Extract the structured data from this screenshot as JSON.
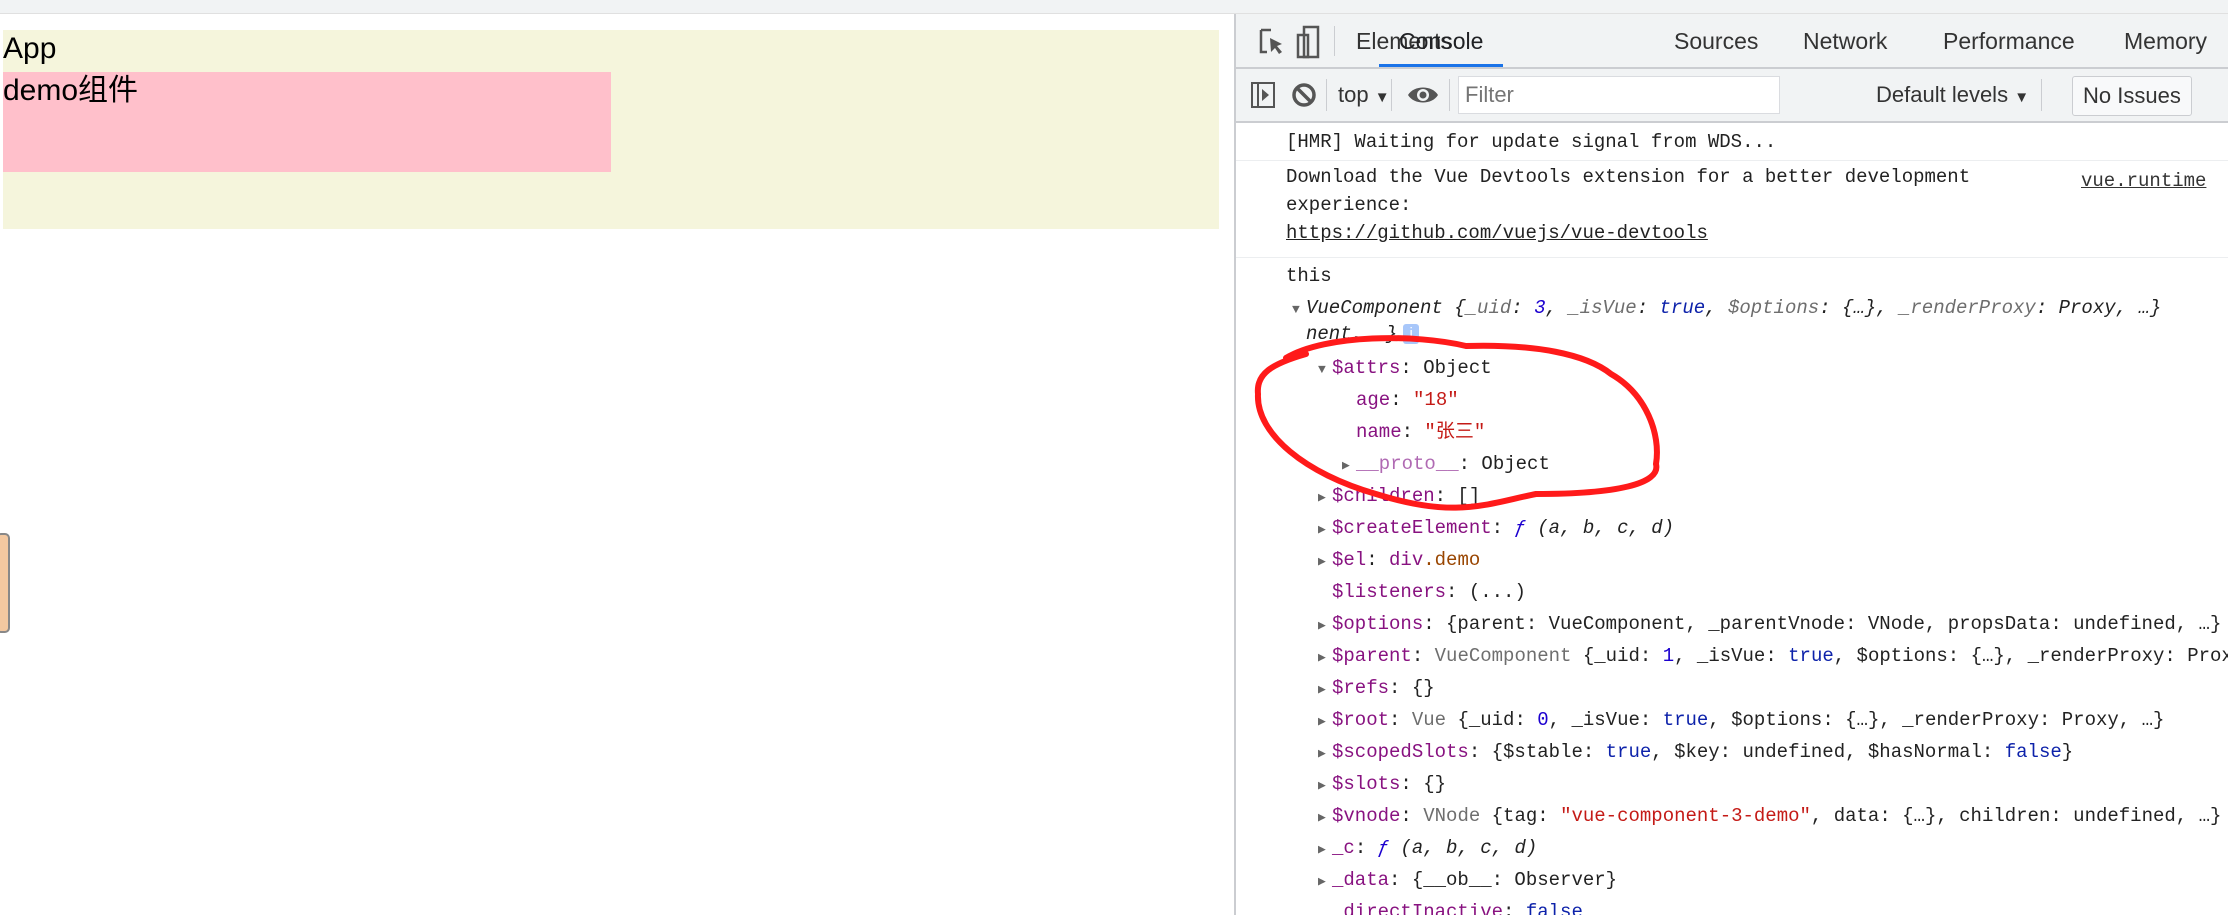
{
  "page": {
    "app_label": "App",
    "demo_label": "demo组件"
  },
  "devtools": {
    "tabs": [
      {
        "label": "Elements",
        "active": false
      },
      {
        "label": "Console",
        "active": true
      },
      {
        "label": "Sources",
        "active": false
      },
      {
        "label": "Network",
        "active": false
      },
      {
        "label": "Performance",
        "active": false
      },
      {
        "label": "Memory",
        "active": false
      }
    ],
    "toolbar": {
      "context": "top",
      "filter_placeholder": "Filter",
      "levels": "Default levels",
      "issues": "No Issues"
    },
    "messages": {
      "hmr": "[HMR] Waiting for update signal from WDS...",
      "vue_devtools_line1": "Download the Vue Devtools extension for a better development",
      "vue_devtools_line2": "experience:",
      "vue_devtools_link": "https://github.com/vuejs/vue-devtools",
      "source_link": "vue.runtime",
      "log_label": "this"
    },
    "colors": {
      "accent": "#1a73e8",
      "annotation": "#ff1a1a"
    },
    "tree": [
      {
        "indent": 0,
        "arrow": "down",
        "segs": [
          [
            "VueComponent {",
            "t i"
          ],
          [
            "_uid",
            "g i"
          ],
          [
            ": ",
            "t i"
          ],
          [
            "3",
            "n i"
          ],
          [
            ", ",
            "t i"
          ],
          [
            "_isVue",
            "g i"
          ],
          [
            ": ",
            "t i"
          ],
          [
            "true",
            "b i"
          ],
          [
            ", ",
            "t i"
          ],
          [
            "$options",
            "g i"
          ],
          [
            ": {…}, ",
            "t i"
          ],
          [
            "_renderProxy",
            "g i"
          ],
          [
            ": Proxy, …}",
            "t i"
          ]
        ]
      },
      {
        "indent": 0,
        "arrow": "",
        "segs": [
          [
            "nent, …}",
            "t i"
          ]
        ],
        "badge": "i"
      },
      {
        "indent": 1,
        "arrow": "down",
        "segs": [
          [
            "$attrs",
            "k"
          ],
          [
            ": Object",
            "t"
          ]
        ]
      },
      {
        "indent": 2,
        "arrow": "",
        "segs": [
          [
            "age",
            "k"
          ],
          [
            ": ",
            "t"
          ],
          [
            "\"18\"",
            "s"
          ]
        ]
      },
      {
        "indent": 2,
        "arrow": "",
        "segs": [
          [
            "name",
            "k"
          ],
          [
            ": ",
            "t"
          ],
          [
            "\"张三\"",
            "s"
          ]
        ]
      },
      {
        "indent": 2,
        "arrow": "right",
        "segs": [
          [
            "__proto__",
            "kd"
          ],
          [
            ": Object",
            "t"
          ]
        ]
      },
      {
        "indent": 1,
        "arrow": "right",
        "segs": [
          [
            "$children",
            "k"
          ],
          [
            ": []",
            "t"
          ]
        ]
      },
      {
        "indent": 1,
        "arrow": "right",
        "segs": [
          [
            "$createElement",
            "k"
          ],
          [
            ": ",
            "t"
          ],
          [
            "ƒ",
            "n i"
          ],
          [
            " (a, b, c, d)",
            "t i"
          ]
        ]
      },
      {
        "indent": 1,
        "arrow": "right",
        "segs": [
          [
            "$el",
            "k"
          ],
          [
            ": ",
            "t"
          ],
          [
            "div",
            "k"
          ],
          [
            ".demo",
            "tag"
          ]
        ]
      },
      {
        "indent": 1,
        "arrow": "",
        "segs": [
          [
            "$listeners",
            "k"
          ],
          [
            ": (...)",
            "t"
          ]
        ]
      },
      {
        "indent": 1,
        "arrow": "right",
        "segs": [
          [
            "$options",
            "k"
          ],
          [
            ": {parent: VueComponent, _parentVnode: VNode, propsData: undefined, …}",
            "t"
          ]
        ]
      },
      {
        "indent": 1,
        "arrow": "right",
        "segs": [
          [
            "$parent",
            "k"
          ],
          [
            ": ",
            "t"
          ],
          [
            "VueComponent ",
            "g"
          ],
          [
            "{_uid: ",
            "t"
          ],
          [
            "1",
            "n"
          ],
          [
            ", _isVue: ",
            "t"
          ],
          [
            "true",
            "b"
          ],
          [
            ", $options: {…}, _renderProxy: Proxy, …}",
            "t"
          ]
        ]
      },
      {
        "indent": 1,
        "arrow": "right",
        "segs": [
          [
            "$refs",
            "k"
          ],
          [
            ": {}",
            "t"
          ]
        ]
      },
      {
        "indent": 1,
        "arrow": "right",
        "segs": [
          [
            "$root",
            "k"
          ],
          [
            ": ",
            "t"
          ],
          [
            "Vue ",
            "g"
          ],
          [
            "{_uid: ",
            "t"
          ],
          [
            "0",
            "n"
          ],
          [
            ", _isVue: ",
            "t"
          ],
          [
            "true",
            "b"
          ],
          [
            ", $options: {…}, _renderProxy: Proxy, …}",
            "t"
          ]
        ]
      },
      {
        "indent": 1,
        "arrow": "right",
        "segs": [
          [
            "$scopedSlots",
            "k"
          ],
          [
            ": {$stable: ",
            "t"
          ],
          [
            "true",
            "b"
          ],
          [
            ", $key: undefined, $hasNormal: ",
            "t"
          ],
          [
            "false",
            "b"
          ],
          [
            "}",
            "t"
          ]
        ]
      },
      {
        "indent": 1,
        "arrow": "right",
        "segs": [
          [
            "$slots",
            "k"
          ],
          [
            ": {}",
            "t"
          ]
        ]
      },
      {
        "indent": 1,
        "arrow": "right",
        "segs": [
          [
            "$vnode",
            "k"
          ],
          [
            ": ",
            "t"
          ],
          [
            "VNode ",
            "g"
          ],
          [
            "{tag: ",
            "t"
          ],
          [
            "\"vue-component-3-demo\"",
            "s"
          ],
          [
            ", data: {…}, children: undefined, …}",
            "t"
          ]
        ]
      },
      {
        "indent": 1,
        "arrow": "right",
        "segs": [
          [
            "_c",
            "k"
          ],
          [
            ": ",
            "t"
          ],
          [
            "ƒ",
            "n i"
          ],
          [
            " (a, b, c, d)",
            "t i"
          ]
        ]
      },
      {
        "indent": 1,
        "arrow": "right",
        "segs": [
          [
            "_data",
            "k"
          ],
          [
            ": {__ob__: Observer}",
            "t"
          ]
        ]
      },
      {
        "indent": 1,
        "arrow": "",
        "segs": [
          [
            "_directInactive",
            "k"
          ],
          [
            ": ",
            "t"
          ],
          [
            "false",
            "b"
          ]
        ]
      }
    ]
  }
}
